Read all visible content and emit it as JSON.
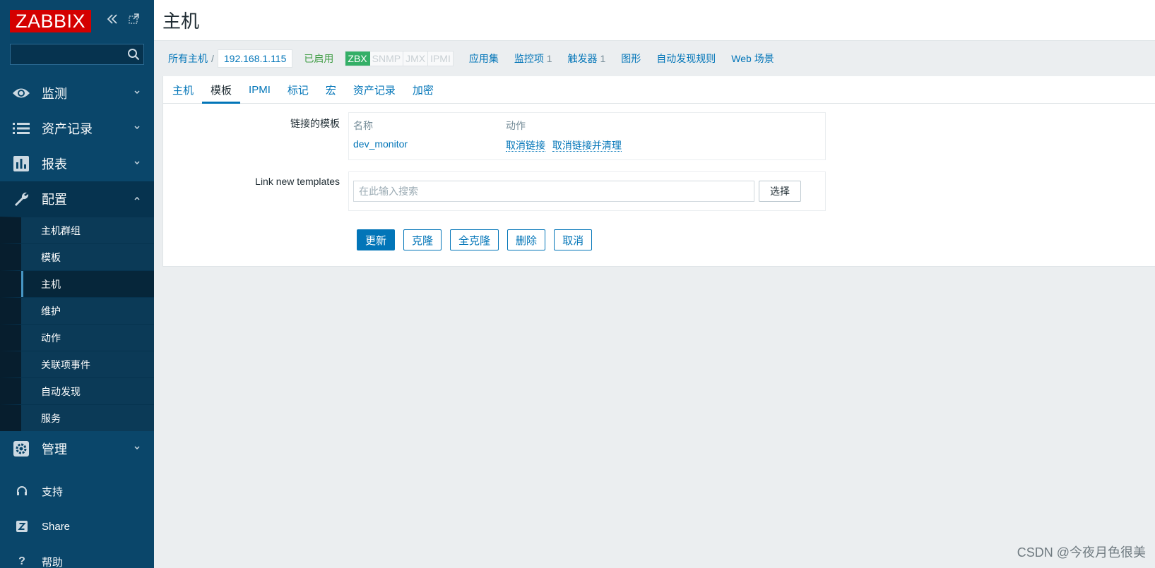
{
  "sidebar": {
    "logo": "ZABBIX",
    "search_placeholder": "",
    "menu": [
      {
        "label": "监测",
        "icon": "eye-icon"
      },
      {
        "label": "资产记录",
        "icon": "list-icon"
      },
      {
        "label": "报表",
        "icon": "bar-chart-icon"
      },
      {
        "label": "配置",
        "icon": "wrench-icon"
      }
    ],
    "submenu": [
      "主机群组",
      "模板",
      "主机",
      "维护",
      "动作",
      "关联项事件",
      "自动发现",
      "服务"
    ],
    "admin": {
      "label": "管理",
      "icon": "gear-icon"
    },
    "bottom": [
      {
        "label": "支持",
        "icon": "headset-icon"
      },
      {
        "label": "Share",
        "icon": "share-z-icon"
      },
      {
        "label": "帮助",
        "icon": "help-icon"
      }
    ]
  },
  "header": {
    "title": "主机"
  },
  "breadcrumb": {
    "all_hosts": "所有主机",
    "separator": "/",
    "current": "192.168.1.115",
    "status": "已启用",
    "availability": [
      "ZBX",
      "SNMP",
      "JMX",
      "IPMI"
    ],
    "links": [
      {
        "label": "应用集",
        "count": ""
      },
      {
        "label": "监控项",
        "count": "1"
      },
      {
        "label": "触发器",
        "count": "1"
      },
      {
        "label": "图形",
        "count": ""
      },
      {
        "label": "自动发现规则",
        "count": ""
      },
      {
        "label": "Web 场景",
        "count": ""
      }
    ]
  },
  "tabs": [
    "主机",
    "模板",
    "IPMI",
    "标记",
    "宏",
    "资产记录",
    "加密"
  ],
  "active_tab": "模板",
  "form": {
    "linked_label": "链接的模板",
    "col_name": "名称",
    "col_action": "动作",
    "template_name": "dev_monitor",
    "unlink": "取消链接",
    "unlink_clear": "取消链接并清理",
    "new_label": "Link new templates",
    "search_placeholder": "在此输入搜索",
    "select_button": "选择"
  },
  "buttons": {
    "update": "更新",
    "clone": "克隆",
    "full_clone": "全克隆",
    "delete": "删除",
    "cancel": "取消"
  },
  "watermark": "CSDN @今夜月色很美",
  "colors": {
    "sidebar": "#0a466a",
    "logo_red": "#d40000",
    "link_blue": "#0275b8",
    "zbx_green": "#34af67",
    "enabled_green": "#429e47"
  }
}
